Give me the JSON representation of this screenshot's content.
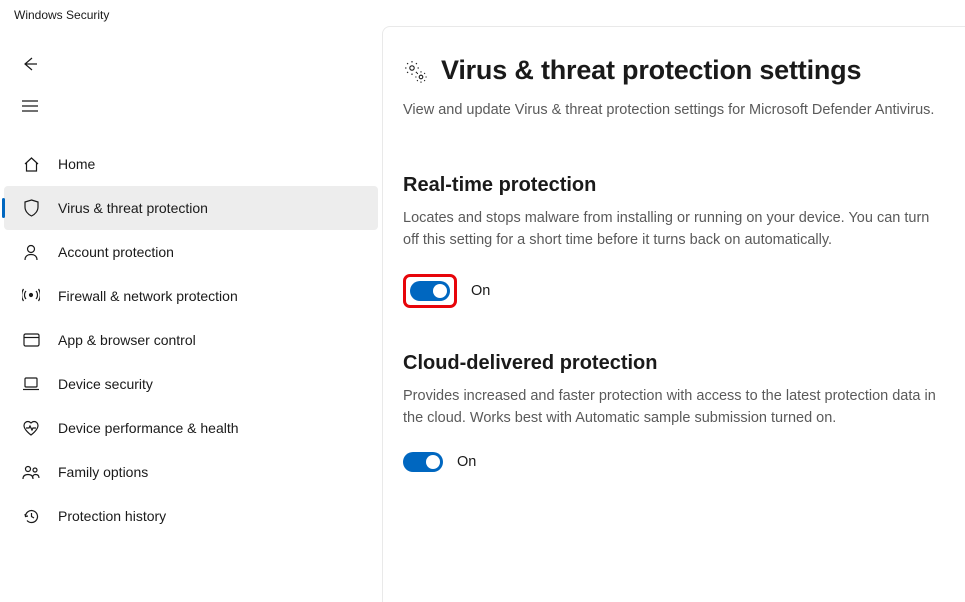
{
  "app": {
    "title": "Windows Security"
  },
  "sidebar": {
    "items": [
      {
        "label": "Home"
      },
      {
        "label": "Virus & threat protection"
      },
      {
        "label": "Account protection"
      },
      {
        "label": "Firewall & network protection"
      },
      {
        "label": "App & browser control"
      },
      {
        "label": "Device security"
      },
      {
        "label": "Device performance & health"
      },
      {
        "label": "Family options"
      },
      {
        "label": "Protection history"
      }
    ]
  },
  "page": {
    "title": "Virus & threat protection settings",
    "subtitle": "View and update Virus & threat protection settings for Microsoft Defender Antivirus."
  },
  "sections": {
    "realtime": {
      "title": "Real-time protection",
      "desc": "Locates and stops malware from installing or running on your device. You can turn off this setting for a short time before it turns back on automatically.",
      "state_label": "On"
    },
    "cloud": {
      "title": "Cloud-delivered protection",
      "desc": "Provides increased and faster protection with access to the latest protection data in the cloud. Works best with Automatic sample submission turned on.",
      "state_label": "On"
    }
  }
}
